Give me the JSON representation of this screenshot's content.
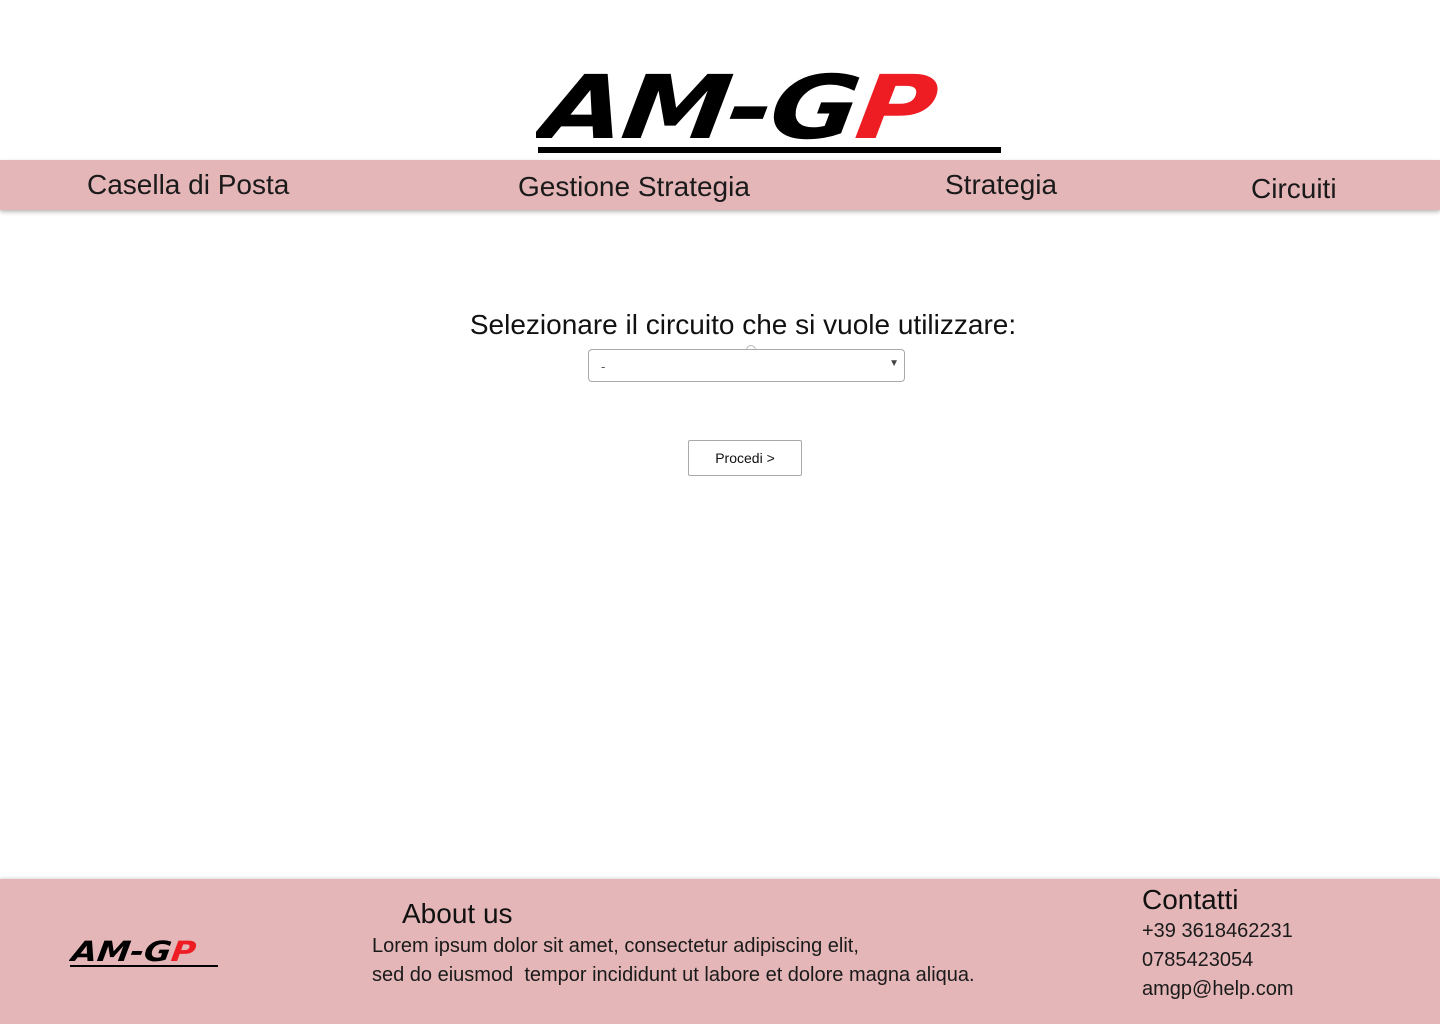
{
  "header": {
    "logo_text_black": "AM-G",
    "logo_text_red": "P",
    "brand_colors": {
      "black": "#000000",
      "red": "#ee1d23"
    }
  },
  "nav": {
    "items": [
      {
        "label": "Casella di Posta"
      },
      {
        "label": "Gestione Strategia"
      },
      {
        "label": "Strategia"
      },
      {
        "label": "Circuiti"
      }
    ],
    "background": "#e4b6b8"
  },
  "main": {
    "prompt": "Selezionare il circuito che si vuole utilizzare:",
    "select": {
      "selected_value": "-"
    },
    "proceed_label": "Procedi >"
  },
  "footer": {
    "background": "#e4b6b8",
    "about_title": "About us",
    "about_line_1": "Lorem ipsum dolor sit amet, consectetur adipiscing elit,",
    "about_line_2": "sed do eiusmod  tempor incididunt ut labore et dolore magna aliqua.",
    "contact_title": "Contatti",
    "phone_1": "+39 3618462231",
    "phone_2": "0785423054",
    "email": "amgp@help.com"
  }
}
